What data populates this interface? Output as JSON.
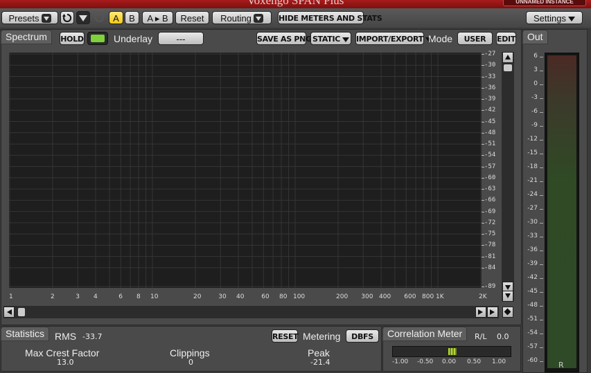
{
  "window": {
    "title": "Voxengo SPAN Plus",
    "instance_badge": "UNNAMED INSTANCE"
  },
  "toolbar": {
    "presets_label": "Presets",
    "undo_icon": "undo-icon",
    "a_label": "A",
    "b_label": "B",
    "ab_copy_label": "A ▸ B",
    "reset_label": "Reset",
    "routing_label": "Routing",
    "hide_meters_label": "HIDE METERS AND STATS",
    "settings_label": "Settings"
  },
  "spectrum": {
    "panel_label": "Spectrum",
    "hold_label": "HOLD",
    "underlay_label": "Underlay",
    "underlay_value": "---",
    "save_png_label": "SAVE AS PNG",
    "static_label": "STATIC",
    "import_export_label": "IMPORT/EXPORT",
    "mode_label": "Mode",
    "mode_value": "USER",
    "edit_label": "EDIT",
    "freq_labels": [
      "1",
      "2",
      "3",
      "4",
      "6",
      "8",
      "10",
      "20",
      "30",
      "40",
      "60",
      "80",
      "100",
      "200",
      "300",
      "400",
      "600",
      "800",
      "1K",
      "2K"
    ],
    "db_labels": [
      "-27",
      "-30",
      "-33",
      "-36",
      "-39",
      "-42",
      "-45",
      "-48",
      "-51",
      "-54",
      "-57",
      "-60",
      "-63",
      "-66",
      "-69",
      "-72",
      "-75",
      "-78",
      "-81",
      "-84",
      "-89"
    ]
  },
  "out": {
    "panel_label": "Out",
    "scale": [
      "6",
      "3",
      "0",
      "-3",
      "-6",
      "-9",
      "-12",
      "-15",
      "-18",
      "-21",
      "-24",
      "-27",
      "-30",
      "-33",
      "-36",
      "-39",
      "-42",
      "-45",
      "-48",
      "-51",
      "-54",
      "-57",
      "-60"
    ],
    "channel_label": "R"
  },
  "statistics": {
    "panel_label": "Statistics",
    "rms_label": "RMS",
    "rms_value": "-33.7",
    "reset_label": "RESET",
    "metering_label": "Metering",
    "metering_value": "DBFS",
    "max_crest_label": "Max Crest Factor",
    "max_crest_value": "13.0",
    "clippings_label": "Clippings",
    "clippings_value": "0",
    "peak_label": "Peak",
    "peak_value": "-21.4"
  },
  "correlation": {
    "panel_label": "Correlation Meter",
    "channel_label": "R/L",
    "value": "0.0",
    "correlation_level": 0.0,
    "scale": [
      "-1.00",
      "-0.50",
      "0.00",
      "0.50",
      "1.00"
    ]
  },
  "colors": {
    "title_bar": "#9a1a1a",
    "hold_indicator": "#7fd13b",
    "ab_active": "#f5c818",
    "meter_bar": "#2f4a25",
    "correlation_marker": "#b8d83a"
  }
}
